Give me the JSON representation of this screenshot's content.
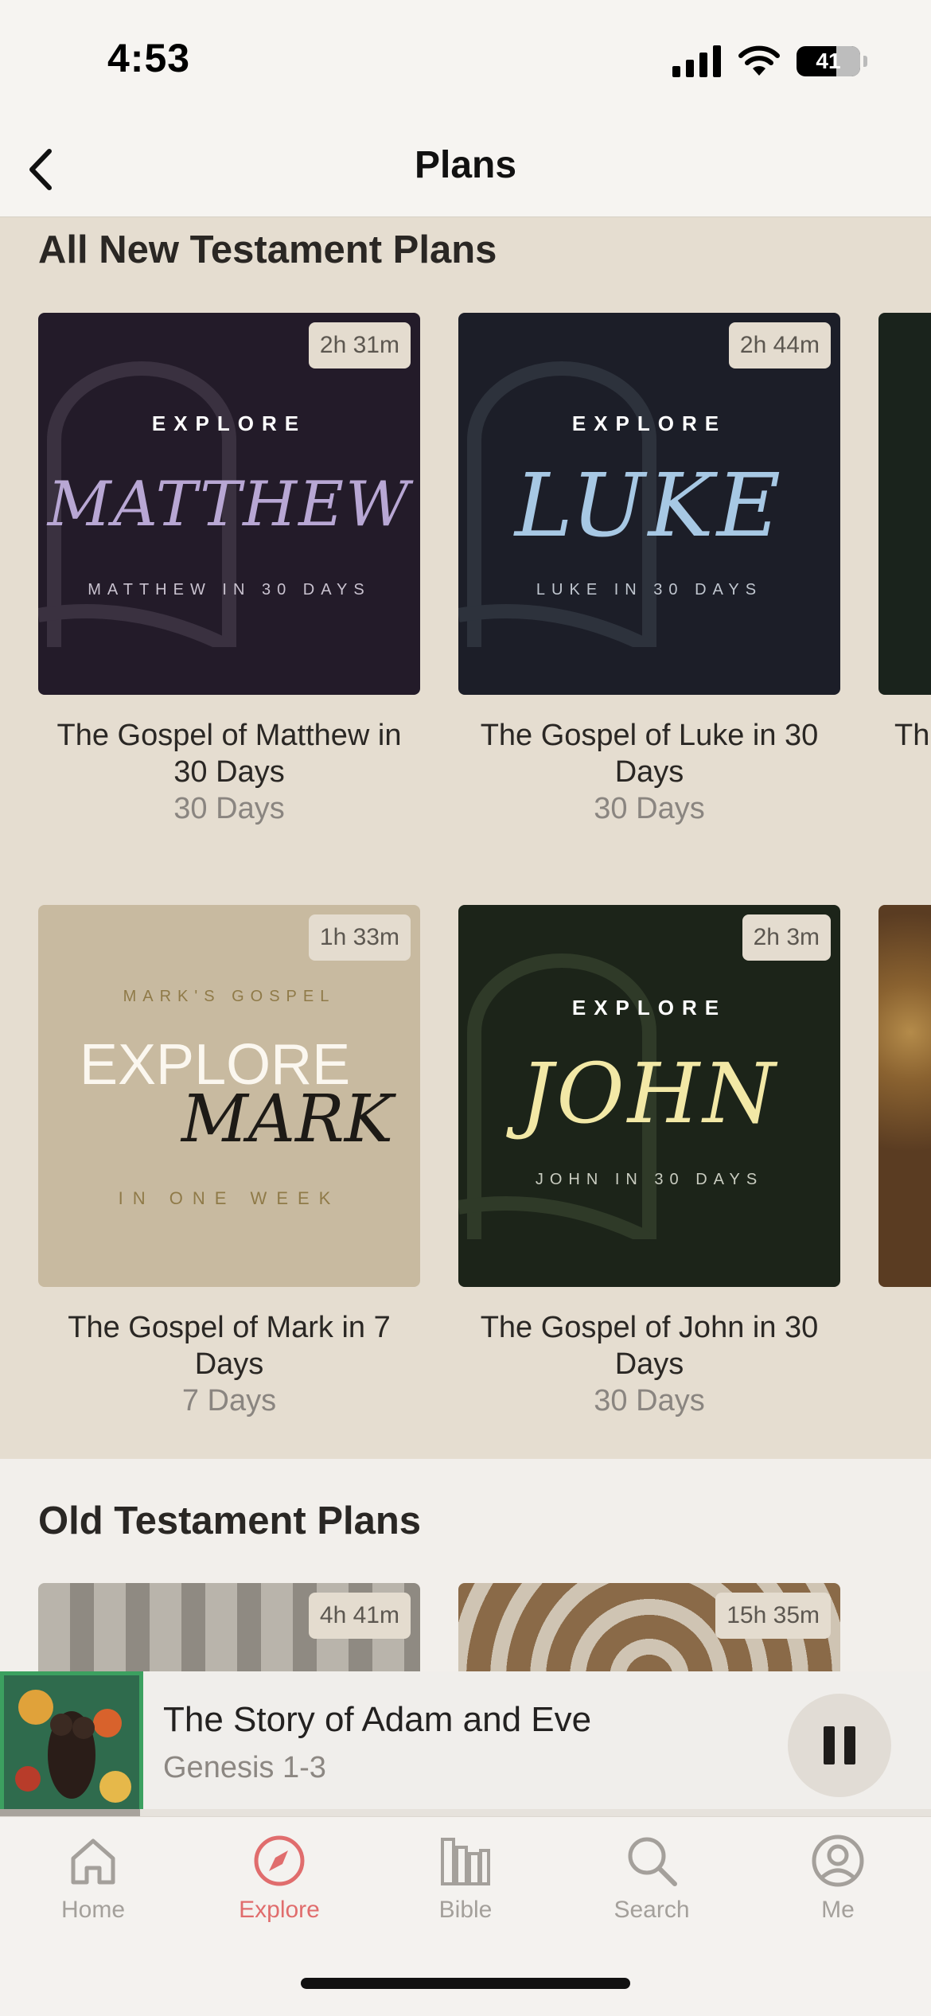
{
  "status_bar": {
    "time": "4:53",
    "battery": "41"
  },
  "nav": {
    "title": "Plans"
  },
  "sections": {
    "new_testament": {
      "title": "All New Testament Plans"
    },
    "old_testament": {
      "title": "Old Testament Plans"
    }
  },
  "cards": [
    {
      "duration": "2h 31m",
      "cover_explore": "EXPLORE",
      "cover_name": "MATTHEW",
      "cover_sub": "MATTHEW IN 30 DAYS",
      "title": "The Gospel of Matthew in 30 Days",
      "days": "30 Days",
      "bg": "#231b29",
      "name_color": "#b8a7d4"
    },
    {
      "duration": "2h 44m",
      "cover_explore": "EXPLORE",
      "cover_name": "LUKE",
      "cover_sub": "LUKE IN 30 DAYS",
      "title": "The Gospel of Luke in 30 Days",
      "days": "30 Days",
      "bg": "#1c1e28",
      "name_color": "#a7c8e4"
    },
    {
      "duration": "1h 33m",
      "cover_top": "MARK'S GOSPEL",
      "cover_explore": "EXPLORE",
      "cover_name": "MARK",
      "cover_sub": "IN ONE WEEK",
      "title": "The Gospel of Mark in 7 Days",
      "days": "7 Days",
      "bg": "#c8baa0"
    },
    {
      "duration": "2h 3m",
      "cover_explore": "EXPLORE",
      "cover_name": "JOHN",
      "cover_sub": "JOHN IN 30 DAYS",
      "title": "The Gospel of John in 30 Days",
      "days": "30 Days",
      "bg": "#1c2419",
      "name_color": "#f2e8a6"
    },
    {
      "partial_title": "Th"
    },
    {
      "duration": "4h 41m"
    },
    {
      "duration": "15h 35m"
    }
  ],
  "now_playing": {
    "title": "The Story of Adam and Eve",
    "subtitle": "Genesis 1-3",
    "progress": 0.15
  },
  "tabs": [
    {
      "label": "Home",
      "icon": "home-icon"
    },
    {
      "label": "Explore",
      "icon": "compass-icon",
      "active": true
    },
    {
      "label": "Bible",
      "icon": "books-icon"
    },
    {
      "label": "Search",
      "icon": "search-icon"
    },
    {
      "label": "Me",
      "icon": "profile-icon"
    }
  ],
  "colors": {
    "accent": "#e06d6d",
    "background": "#e5ddd0"
  }
}
